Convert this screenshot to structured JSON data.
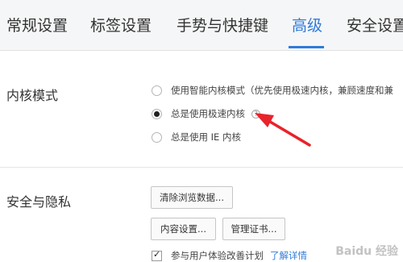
{
  "tabs": [
    {
      "label": "常规设置",
      "active": false
    },
    {
      "label": "标签设置",
      "active": false
    },
    {
      "label": "手势与快捷键",
      "active": false
    },
    {
      "label": "高级",
      "active": true
    },
    {
      "label": "安全设置",
      "active": false
    }
  ],
  "kernel": {
    "title": "内核模式",
    "options": [
      {
        "label": "使用智能内核模式（优先使用极速内核，兼顾速度和兼",
        "checked": false
      },
      {
        "label": "总是使用极速内核",
        "checked": true,
        "help": "?"
      },
      {
        "label": "总是使用 IE 内核",
        "checked": false
      }
    ]
  },
  "security": {
    "title": "安全与隐私",
    "clear_button": "清除浏览数据...",
    "content_settings_button": "内容设置...",
    "certificates_button": "管理证书...",
    "checkbox_label": "参与用户体验改善计划",
    "checkbox_checked": true,
    "learn_more_link": "了解详情"
  },
  "colors": {
    "accent": "#2f7bd9",
    "arrow": "#e8232b"
  },
  "watermark": "Baidu 经验"
}
